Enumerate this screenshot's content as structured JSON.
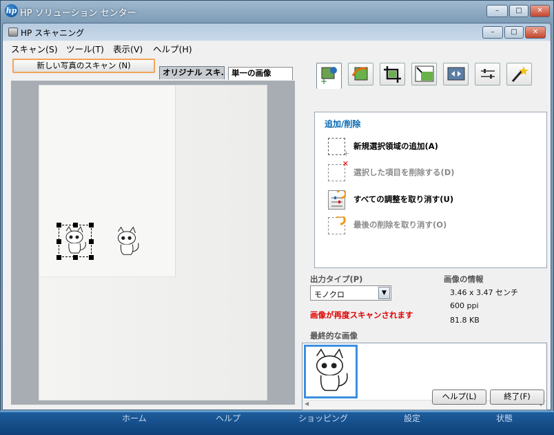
{
  "outer": {
    "title": "HP ソリューション センター",
    "min": "–",
    "max": "□",
    "close": "✕"
  },
  "bottom_nav": [
    "ホーム",
    "ヘルプ",
    "ショッピング",
    "設定",
    "状態"
  ],
  "window": {
    "title": "HP スキャニング",
    "min": "–",
    "max": "□",
    "close": "✕"
  },
  "menu": [
    "スキャン(S)",
    "ツール(T)",
    "表示(V)",
    "ヘルプ(H)"
  ],
  "left": {
    "new_scan": "新しい写真のスキャン (N)",
    "tab_original": "オリジナル スキ...",
    "tab_single": "単一の画像"
  },
  "right": {
    "toolbar_icons": [
      "add-remove-icon",
      "adjust-color-icon",
      "crop-icon",
      "resize-icon",
      "flip-icon",
      "sliders-icon",
      "magic-wand-icon"
    ],
    "panel_title": "追加/削除",
    "options": [
      {
        "label": "新規選択領域の追加(A)",
        "enabled": true
      },
      {
        "label": "選択した項目を削除する(D)",
        "enabled": false
      },
      {
        "label": "すべての調整を取り消す(U)",
        "enabled": true
      },
      {
        "label": "最後の削除を取り消す(O)",
        "enabled": false
      }
    ],
    "output_type_label": "出力タイプ(P)",
    "output_type_value": "モノクロ",
    "image_info_label": "画像の情報",
    "info_size": "3.46 x 3.47 センチ",
    "info_ppi": "600 ppi",
    "info_kb": "81.8 KB",
    "rescan_warning": "画像が再度スキャンされます",
    "final_image_label": "最終的な画像",
    "help_button": "ヘルプ(L)",
    "exit_button": "終了(F)"
  },
  "colors": {
    "accent": "#0066b3",
    "warning": "#e00000",
    "nav_arrow": "#e46c0a"
  }
}
